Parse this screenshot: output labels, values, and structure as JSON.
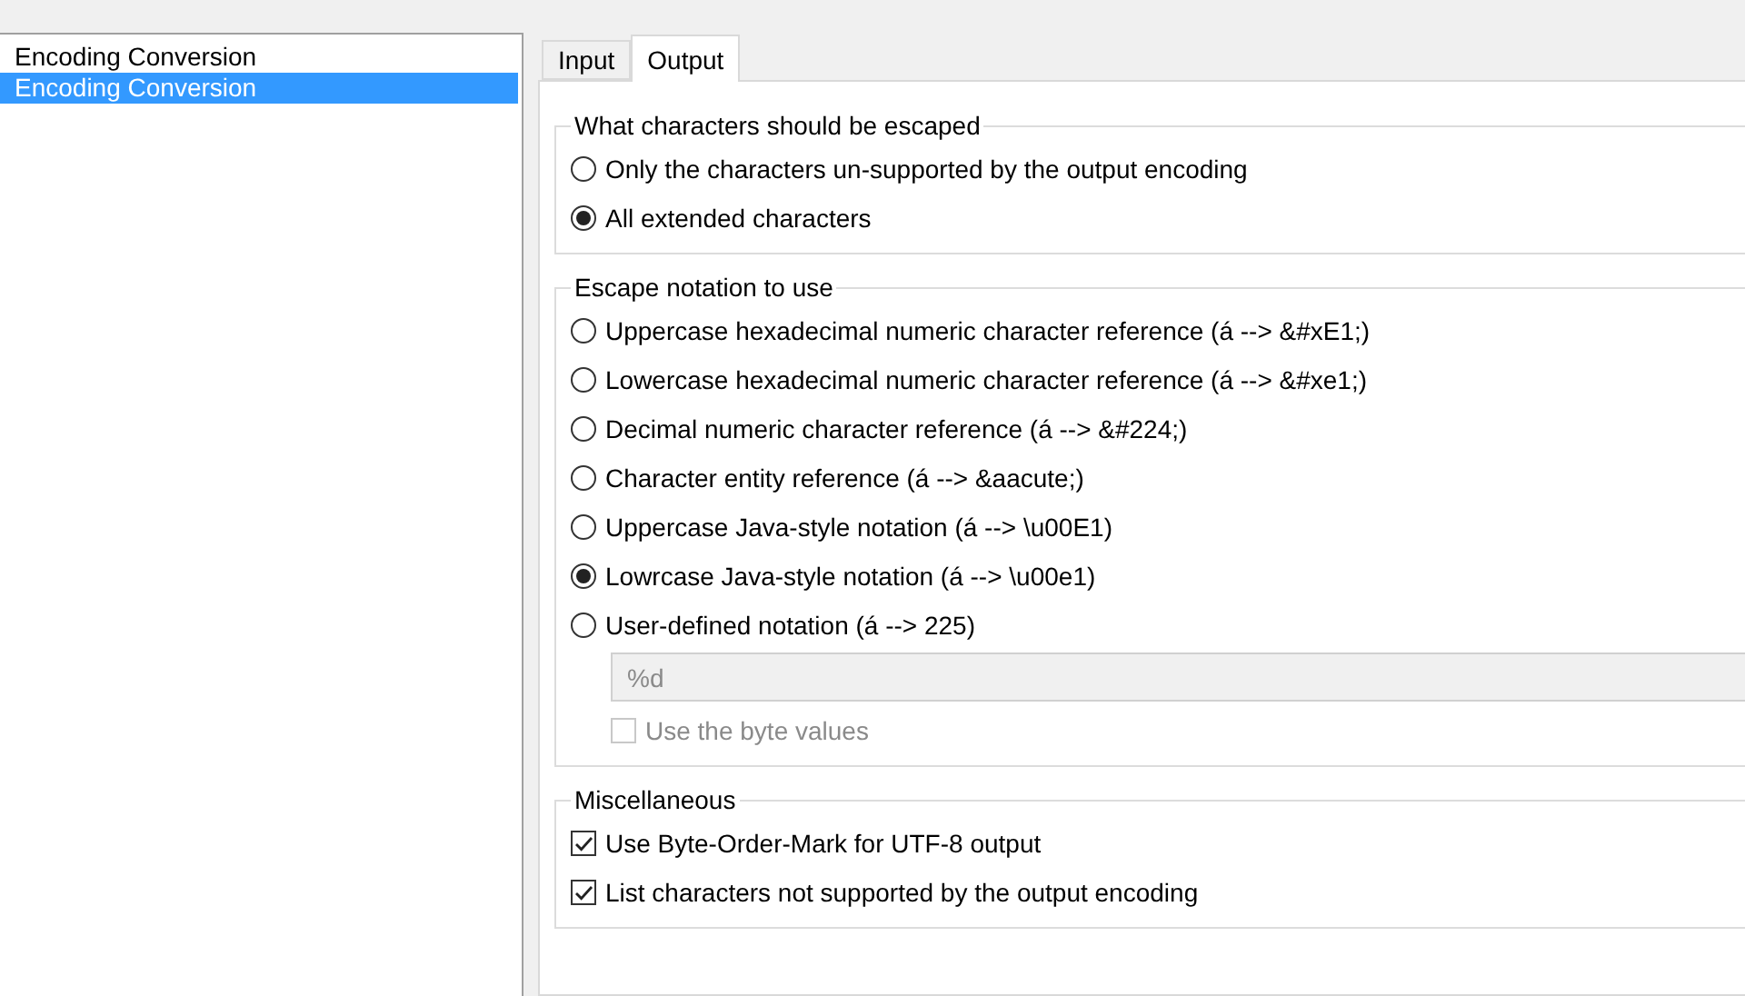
{
  "tree": {
    "items": [
      {
        "label": "Encoding Conversion",
        "selected": false
      },
      {
        "label": "Encoding Conversion",
        "selected": true
      }
    ]
  },
  "tabs": [
    {
      "label": "Input",
      "selected": false
    },
    {
      "label": "Output",
      "selected": true
    }
  ],
  "groups": [
    {
      "title": "What characters should be escaped",
      "options": [
        {
          "kind": "radio",
          "label": "Only the characters un-supported by the output encoding",
          "selected": false
        },
        {
          "kind": "radio",
          "label": "All extended characters",
          "selected": true
        }
      ]
    },
    {
      "title": "Escape notation to use",
      "options": [
        {
          "kind": "radio",
          "label": "Uppercase hexadecimal numeric character reference (á --> &#xE1;)",
          "selected": false
        },
        {
          "kind": "radio",
          "label": "Lowercase hexadecimal numeric character reference (á --> &#xe1;)",
          "selected": false
        },
        {
          "kind": "radio",
          "label": "Decimal numeric character reference (á --> &#224;)",
          "selected": false
        },
        {
          "kind": "radio",
          "label": "Character entity reference (á --> &aacute;)",
          "selected": false
        },
        {
          "kind": "radio",
          "label": "Uppercase Java-style notation (á --> \\u00E1)",
          "selected": false
        },
        {
          "kind": "radio",
          "label": "Lowrcase Java-style notation (á --> \\u00e1)",
          "selected": true
        },
        {
          "kind": "radio",
          "label": "User-defined notation (á --> 225)",
          "selected": false
        },
        {
          "kind": "field",
          "value": "%d",
          "disabled": true
        },
        {
          "kind": "checkbox",
          "label": "Use the byte values",
          "checked": false,
          "disabled": true
        }
      ]
    },
    {
      "title": "Miscellaneous",
      "options": [
        {
          "kind": "checkbox",
          "label": "Use Byte-Order-Mark for UTF-8 output",
          "checked": true,
          "disabled": false
        },
        {
          "kind": "checkbox",
          "label": "List characters not supported by the output encoding",
          "checked": true,
          "disabled": false
        }
      ]
    }
  ]
}
